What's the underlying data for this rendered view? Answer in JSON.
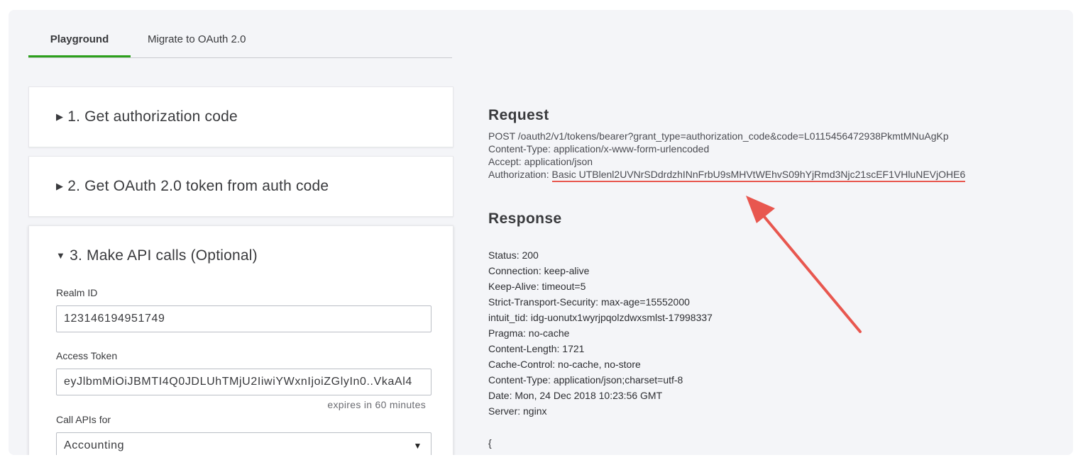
{
  "tabs": [
    {
      "label": "Playground",
      "active": true
    },
    {
      "label": "Migrate to OAuth 2.0",
      "active": false
    }
  ],
  "steps": {
    "step1": {
      "title": "1. Get authorization code",
      "expanded": false
    },
    "step2": {
      "title": "2. Get OAuth 2.0 token from auth code",
      "expanded": false
    },
    "step3": {
      "title": "3. Make API calls (Optional)",
      "expanded": true
    }
  },
  "api_calls": {
    "realm_label": "Realm ID",
    "realm_value": "123146194951749",
    "token_label": "Access Token",
    "token_value": "eyJlbmMiOiJBMTI4Q0JDLUhTMjU2IiwiYWxnIjoiZGlyIn0..VkaAl4",
    "expires": "expires in 60 minutes",
    "call_for_label": "Call APIs for",
    "call_for_value": "Accounting"
  },
  "request": {
    "heading": "Request",
    "lines": [
      "POST /oauth2/v1/tokens/bearer?grant_type=authorization_code&code=L0115456472938PkmtMNuAgKp",
      "Content-Type: application/x-www-form-urlencoded",
      "Accept: application/json"
    ],
    "auth_prefix": "Authorization: ",
    "auth_value": "Basic UTBlenl2UVNrSDdrdzhINnFrbU9sMHVtWEhvS09hYjRmd3Njc21scEF1VHluNEVjOHE6"
  },
  "response": {
    "heading": "Response",
    "lines": [
      "Status: 200",
      "Connection: keep-alive",
      "Keep-Alive: timeout=5",
      "Strict-Transport-Security: max-age=15552000",
      "intuit_tid: idg-uonutx1wyrjpqolzdwxsmlst-17998337",
      "Pragma: no-cache",
      "Content-Length: 1721",
      "Cache-Control: no-cache, no-store",
      "Content-Type: application/json;charset=utf-8",
      "Date: Mon, 24 Dec 2018 10:23:56 GMT",
      "Server: nginx"
    ],
    "body_open": "{"
  },
  "colors": {
    "tab_accent": "#2ca01c",
    "annotation": "#e8574f"
  }
}
